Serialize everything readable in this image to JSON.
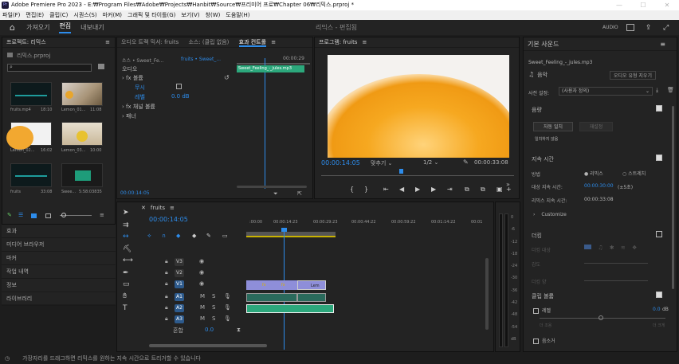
{
  "window": {
    "title": "Adobe Premiere Pro 2023 - E:₩Program Files₩Adobe₩Projects₩Hanbit₩Source₩프리미어 프로₩Chapter 06₩리믹스.prproj *",
    "app_icon": "Pr",
    "minimize": "—",
    "maximize": "☐",
    "close": "✕"
  },
  "menu": [
    "파일(F)",
    "편집(E)",
    "클립(C)",
    "시퀀스(S)",
    "마커(M)",
    "그래픽 및 타이틀(G)",
    "보기(V)",
    "창(W)",
    "도움말(H)"
  ],
  "workspaces": {
    "tabs": [
      {
        "label": "가져오기",
        "active": false
      },
      {
        "label": "편집",
        "active": true
      },
      {
        "label": "내보내기",
        "active": false
      }
    ],
    "title": "리믹스 - 편집됨",
    "audio_label": "AUDIO"
  },
  "project": {
    "title": "프로젝트: 리믹스",
    "menu": "≡",
    "file": "리믹스.prproj",
    "items": [
      {
        "name": "fruits.mp4",
        "dur": "18:10"
      },
      {
        "name": "Lemon_01...",
        "dur": "11:08"
      },
      {
        "name": "Lemon_02...",
        "dur": "16:02"
      },
      {
        "name": "Lemon_03...",
        "dur": "10:00"
      },
      {
        "name": "fruits",
        "dur": "33:08"
      },
      {
        "name": "Swee...",
        "dur": "5:58:03835"
      }
    ]
  },
  "left_panels": [
    "효과",
    "미디어 브라우저",
    "마커",
    "작업 내역",
    "정보",
    "라이브러리"
  ],
  "source": {
    "tab1": "오디오 트랙 믹서: fruits",
    "tab2": "소스: (클립 없음)",
    "tab3": "효과 컨트롤",
    "tab3_menu": "≡",
    "crumb1": "소스 • Sweet_Fe...",
    "crumb2": "fruits • Sweet_...",
    "time_mark": "00:00:29",
    "section": "오디오",
    "fx1": "볼륨",
    "bypass": "무시",
    "level": "레벨",
    "level_val": "0.0 dB",
    "fx2": "채널 볼륨",
    "fx3": "패너",
    "clip": "Sweet_Feeling_-_jules.mp3",
    "timecode": "00:00:14:05"
  },
  "program": {
    "title": "프로그램: fruits",
    "menu": "≡",
    "timecode": "00:00:14:05",
    "fit": "맞추기",
    "quality": "1/2",
    "duration": "00:00:33:08"
  },
  "timeline": {
    "close": "✕",
    "name": "fruits",
    "menu": "≡",
    "timecode": "00:00:14:05",
    "ruler": [
      ":00:00",
      "00:00:14:23",
      "00:00:29:23",
      "00:00:44:22",
      "00:00:59:22",
      "00:01:14:22",
      "00:01"
    ],
    "tracks": [
      {
        "id": "V3",
        "sel": false
      },
      {
        "id": "V2",
        "sel": false
      },
      {
        "id": "V1",
        "sel": true
      },
      {
        "id": "A1",
        "sel": true
      },
      {
        "id": "A2",
        "sel": true
      },
      {
        "id": "A3",
        "sel": true
      }
    ],
    "master": "혼합",
    "master_val": "0.0",
    "clips": {
      "c1": "fx",
      "c2": "fx",
      "c3": "Lem"
    }
  },
  "meter": {
    "scale": [
      "0",
      "-6",
      "-12",
      "-18",
      "-24",
      "-30",
      "-36",
      "-42",
      "-48",
      "-54",
      "dB"
    ]
  },
  "essential": {
    "title": "기본 사운드",
    "menu": "≡",
    "file": "Sweet_Feeling_-_jules.mp3",
    "type": "음악",
    "change_type": "오디오 유형 지우기",
    "preset_label": "사전 설정:",
    "preset_value": "(사용자 정의)",
    "volume": "음량",
    "auto_match": "자동 일치",
    "reset": "재설정",
    "unmatched": "일치하지 않음",
    "duration": "지속 시간",
    "method": "방법",
    "remix": "리믹스",
    "stretch": "스트레치",
    "target_label": "대상 지속 시간:",
    "target_value": "00:00:30:00",
    "target_delta": "(±5초)",
    "remix_label": "리믹스 지속 시간:",
    "remix_value": "00:00:33:08",
    "customize": "Customize",
    "ambience": "더킹",
    "duck_against": "더킹 대상",
    "sensitivity": "감도",
    "ducking_amount": "더킹 양",
    "fade": "페이드 지속 시간",
    "clip_volume": "클립 볼륨",
    "level": "레벨",
    "level_val": "0.0",
    "db": "dB",
    "quiet": "더 조용",
    "loud": "더 크게",
    "mute": "음소거"
  },
  "status": "가장자리를 드래그하면 리믹스를 원하는 지속 시간으로 트리거할 수 있습니다"
}
